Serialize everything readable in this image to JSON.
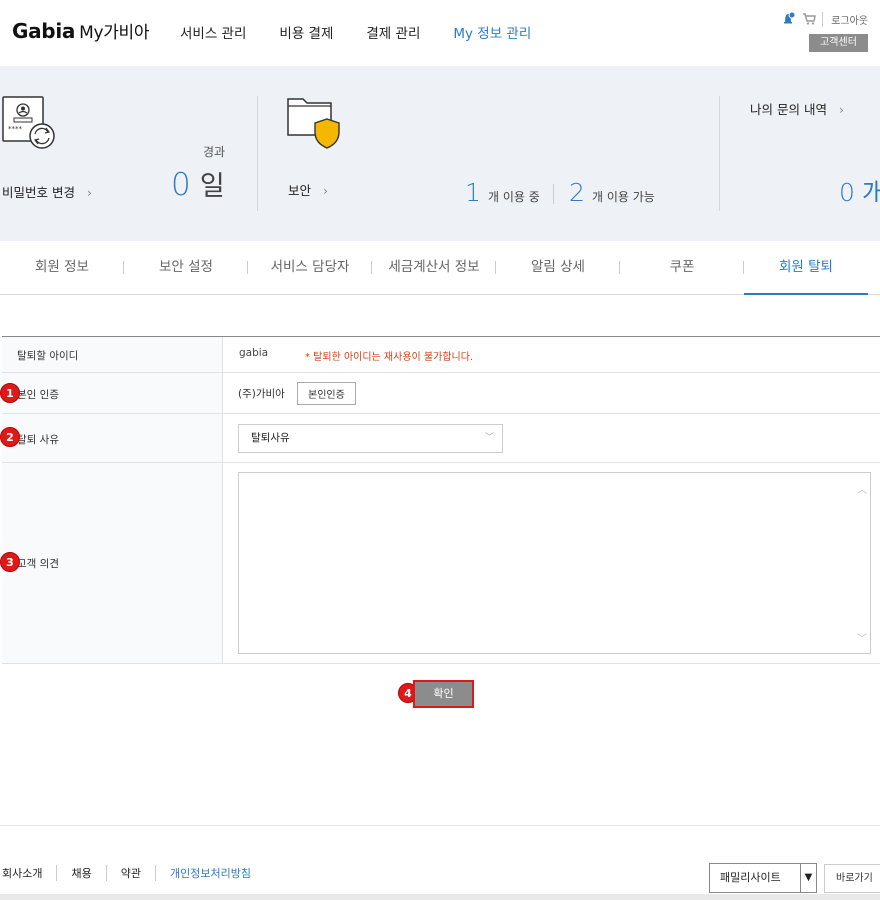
{
  "header": {
    "logo": "Gabia",
    "logo_sub": "My가비아",
    "nav": [
      "서비스 관리",
      "비용 결제",
      "결제 관리",
      "My 정보 관리"
    ],
    "logout": "로그아웃",
    "customer_center": "고객센터"
  },
  "dashboard": {
    "password": {
      "label": "비밀번호 변경",
      "count": "0",
      "unit": "일",
      "elapsed": "경과"
    },
    "security": {
      "label": "보안",
      "in_use_count": "1",
      "in_use_label": "개 이용 중",
      "available_count": "2",
      "available_label": "개 이용 가능"
    },
    "inquiry": {
      "label": "나의 문의 내역",
      "count": "0",
      "unit": "개"
    }
  },
  "tabs": [
    "회원 정보",
    "보안 설정",
    "서비스 담당자",
    "세금계산서 정보",
    "알림 상세",
    "쿠폰",
    "회원 탈퇴"
  ],
  "form": {
    "rows": {
      "id": {
        "label": "탈퇴할 아이디",
        "value": "gabia",
        "notice": "* 탈퇴한 아이디는 재사용이 불가합니다."
      },
      "verify": {
        "label": "본인 인증",
        "value": "(주)가비아",
        "button": "본인인증"
      },
      "reason": {
        "label": "탈퇴 사유",
        "placeholder": "탈퇴사유"
      },
      "opinion": {
        "label": "고객 의견"
      }
    },
    "badges": [
      "1",
      "2",
      "3",
      "4"
    ],
    "confirm": "확인"
  },
  "footer": {
    "links": [
      "회사소개",
      "채용",
      "약관",
      "개인정보처리방침"
    ],
    "family_select": "패밀리사이트",
    "go_button": "바로가기"
  },
  "colors": {
    "accent": "#2e7bc4",
    "badge": "#dc1a1a",
    "notice": "#d4401a"
  }
}
